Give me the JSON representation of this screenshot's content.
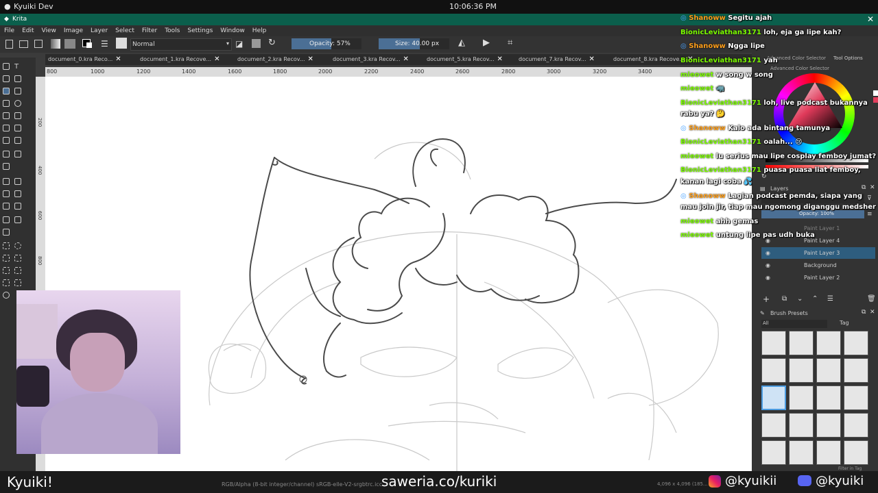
{
  "system_bar": {
    "window_title": "Kyuiki Dev",
    "clock": "10:06:36 PM"
  },
  "app": {
    "title": "Krita"
  },
  "menu": [
    "File",
    "Edit",
    "View",
    "Image",
    "Layer",
    "Select",
    "Filter",
    "Tools",
    "Settings",
    "Window",
    "Help"
  ],
  "toolbar": {
    "blend_mode": "Normal",
    "opacity_label": "Opacity: 57%",
    "size_label": "Size: 40.00 px",
    "opacity_value_percent": 57
  },
  "doc_tabs": [
    "document_0.kra Reco...",
    "document_1.kra Recove...",
    "document_2.kra Recov...",
    "document_3.kra Recov...",
    "document_5.kra Recov...",
    "document_7.kra Recov...",
    "document_8.kra Recove..."
  ],
  "ruler_ticks": [
    "800",
    "1000",
    "1200",
    "1400",
    "1600",
    "1800",
    "2000",
    "2200",
    "2400",
    "2600",
    "2800",
    "3000",
    "3200",
    "3400"
  ],
  "vruler_ticks": [
    "200",
    "400",
    "600",
    "800",
    "1000"
  ],
  "dock": {
    "tab1": "Advanced Color Selector",
    "tab2": "Tool Options",
    "color_title": "Advanced Color Selector",
    "layers_title": "Layers",
    "layers_opacity": "Opacity: 100%",
    "layers": [
      "Paint Layer 1",
      "Paint Layer 4",
      "Paint Layer 3",
      "Background",
      "Paint Layer 2"
    ],
    "brush_title": "Brush Presets",
    "brush_filter": "All",
    "brush_tag": "Tag",
    "filter_in_tag": "Filter in Tag"
  },
  "chat": [
    {
      "user": "Shanoww",
      "msg": "Segitu ajah",
      "mod": true
    },
    {
      "user": "BionicLeviathan3171",
      "msg": "loh, eja ga lipe kah?"
    },
    {
      "user": "Shanoww",
      "msg": "Ngga lipe",
      "mod": true
    },
    {
      "user": "BionicLeviathan3171",
      "msg": "yah"
    },
    {
      "user": "mieowet",
      "msg": "w song w song"
    },
    {
      "user": "mieowet",
      "msg": "🦏"
    },
    {
      "user": "BionicLeviathan3171",
      "msg": "loh, live podcast bukannya"
    },
    {
      "user": "",
      "msg": "rabu ya? 🤔"
    },
    {
      "user": "Shanoww",
      "msg": "Kalo ada bintang tamunya",
      "mod": true
    },
    {
      "user": "BionicLeviathan3171",
      "msg": "oalah... 😢"
    },
    {
      "user": "mieowet",
      "msg": "lu serius mau lipe cosplay femboy jumat?"
    },
    {
      "user": "BionicLeviathan3171",
      "msg": "puasa puasa liat femboy,"
    },
    {
      "user": "",
      "msg": "kanan lagi coba 💦"
    },
    {
      "user": "Shanoww",
      "msg": "Lagian podcast pemda, siapa yang",
      "mod": true
    },
    {
      "user": "",
      "msg": "mau join jir, tiap mau ngomong diganggu medsher"
    },
    {
      "user": "mieowet",
      "msg": "ahh gemas"
    },
    {
      "user": "mieowet",
      "msg": "untung lipe pas udh buka"
    }
  ],
  "status": {
    "left_name": "Kyuiki!",
    "color_space": "RGB/Alpha (8-bit integer/channel)  sRGB-elle-V2-srgbtrc.icc",
    "center_link": "saweria.co/kuriki",
    "dims": "4,096 x 4,096 (185...",
    "instagram": "@kyuikii",
    "discord": "@kyuiki"
  },
  "colors": {
    "accent_teal": "#0b5f4c",
    "chat_green": "#7cfc00",
    "chat_orange": "#ff9f1a",
    "selected_layer": "#2e5d7e"
  },
  "icons": {
    "instagram": "instagram-icon",
    "discord": "discord-icon"
  }
}
